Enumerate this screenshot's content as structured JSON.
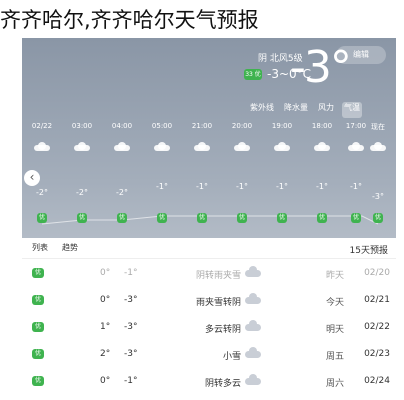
{
  "caption": "齐齐哈尔,齐齐哈尔天气预报",
  "header": {
    "city_chip": "编辑",
    "temperature": "-3°",
    "condition": "阴 北风5级",
    "range": "-3~0°C",
    "aqi": "33 优"
  },
  "tabs": [
    "气温",
    "风力",
    "降水量",
    "紫外线"
  ],
  "hourly": [
    {
      "time": "02/22",
      "temp": "-2°",
      "aqi": "优"
    },
    {
      "time": "03:00",
      "temp": "-2°",
      "aqi": "优"
    },
    {
      "time": "04:00",
      "temp": "-2°",
      "aqi": "优"
    },
    {
      "time": "05:00",
      "temp": "-1°",
      "aqi": "优"
    },
    {
      "time": "21:00",
      "temp": "-1°",
      "aqi": "优"
    },
    {
      "time": "20:00",
      "temp": "-1°",
      "aqi": "优"
    },
    {
      "time": "19:00",
      "temp": "-1°",
      "aqi": "优"
    },
    {
      "time": "18:00",
      "temp": "-1°",
      "aqi": "优"
    },
    {
      "time": "17:00",
      "temp": "-1°",
      "aqi": "优"
    },
    {
      "time": "现在",
      "temp": "-3°",
      "aqi": "优"
    }
  ],
  "panel": {
    "title": "15天预报",
    "trend_label": "趋势",
    "list_label": "列表"
  },
  "days": [
    {
      "date": "02/20",
      "day": "昨天",
      "desc": "阴转雨夹雪",
      "hi": "0°",
      "lo": "-1°",
      "aqi": "优"
    },
    {
      "date": "02/21",
      "day": "今天",
      "desc": "雨夹雪转阴",
      "hi": "0°",
      "lo": "-3°",
      "aqi": "优"
    },
    {
      "date": "02/22",
      "day": "明天",
      "desc": "多云转阴",
      "hi": "1°",
      "lo": "-3°",
      "aqi": "优"
    },
    {
      "date": "02/23",
      "day": "周五",
      "desc": "小雪",
      "hi": "2°",
      "lo": "-3°",
      "aqi": "优"
    },
    {
      "date": "02/24",
      "day": "周六",
      "desc": "阴转多云",
      "hi": "0°",
      "lo": "-1°",
      "aqi": "优"
    }
  ]
}
